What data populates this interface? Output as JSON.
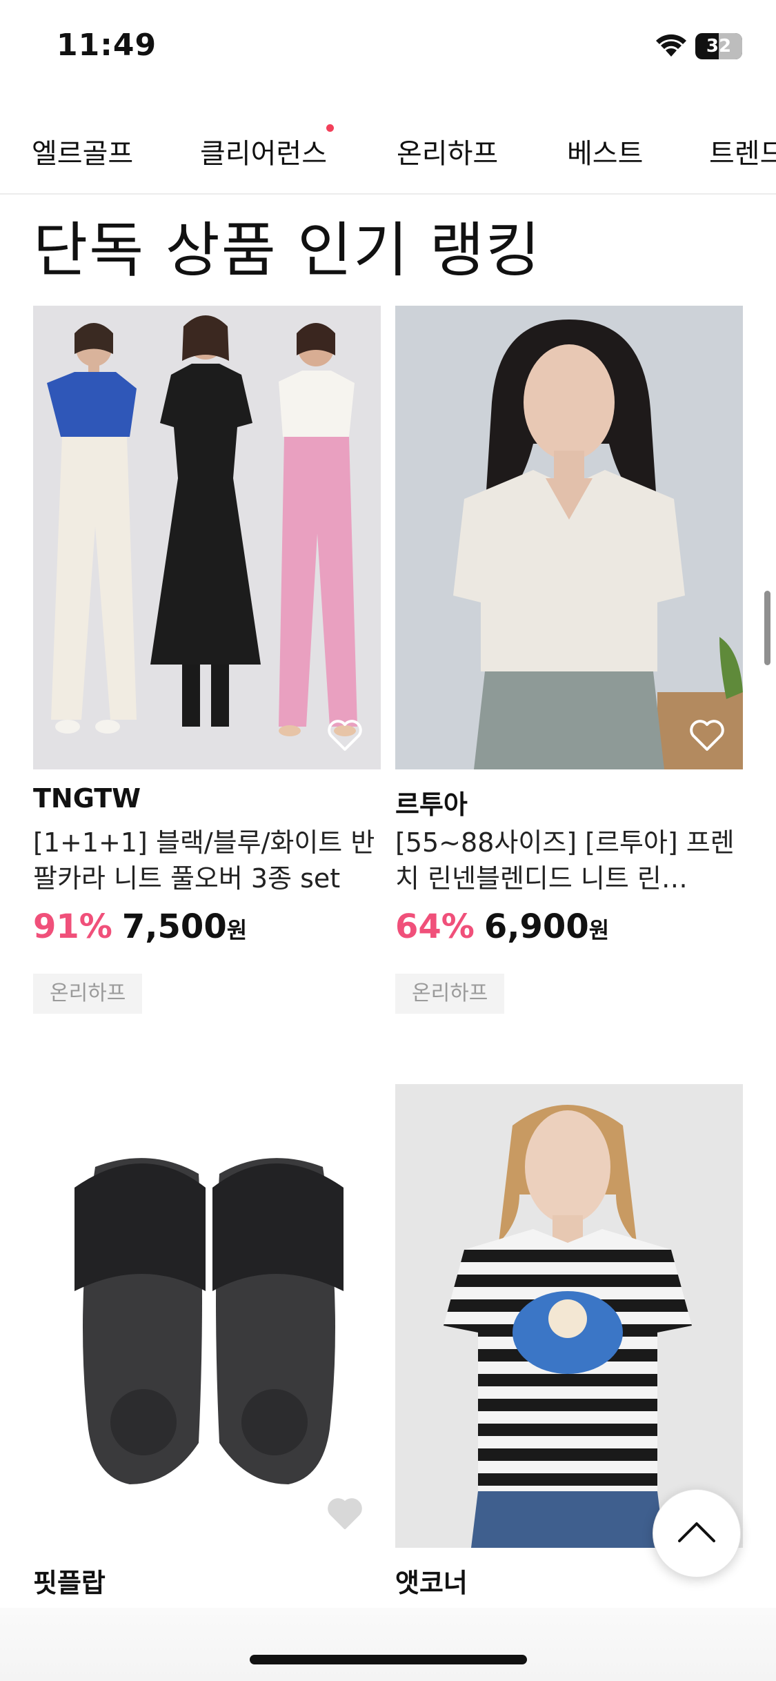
{
  "status_bar": {
    "time": "11:49",
    "battery": "32"
  },
  "tabs": [
    {
      "label": "엘르골프",
      "badge": false
    },
    {
      "label": "클리어런스",
      "badge": true
    },
    {
      "label": "온리하프",
      "badge": false
    },
    {
      "label": "베스트",
      "badge": false
    },
    {
      "label": "트렌드",
      "badge": false
    }
  ],
  "section": {
    "title": "단독 상품 인기 랭킹"
  },
  "products": [
    {
      "brand": "TNGTW",
      "name": "[1+1+1] 블랙/블루/화이트 반팔카라 니트 풀오버 3종 set",
      "discount": "91%",
      "price": "7,500",
      "currency": "원",
      "tag": "온리하프",
      "image": "three-women-knit-polo",
      "liked": false
    },
    {
      "brand": "르투아",
      "name": "[55~88사이즈] [르투아] 프렌치 린넨블렌디드 니트 린…",
      "discount": "64%",
      "price": "6,900",
      "currency": "원",
      "tag": "온리하프",
      "image": "woman-linen-knit",
      "liked": false
    },
    {
      "brand": "핏플랍",
      "name": "",
      "discount": "",
      "price": "",
      "currency": "",
      "tag": "",
      "image": "black-slide-sandals",
      "liked": false
    },
    {
      "brand": "앳코너",
      "name": "",
      "discount": "",
      "price": "",
      "currency": "",
      "tag": "",
      "image": "striped-tshirt-woman",
      "liked": false
    }
  ],
  "colors": {
    "accent_discount": "#f0507a",
    "badge_dot": "#f2405a",
    "tag_bg": "#f3f3f3",
    "tag_text": "#9a9a9a"
  }
}
